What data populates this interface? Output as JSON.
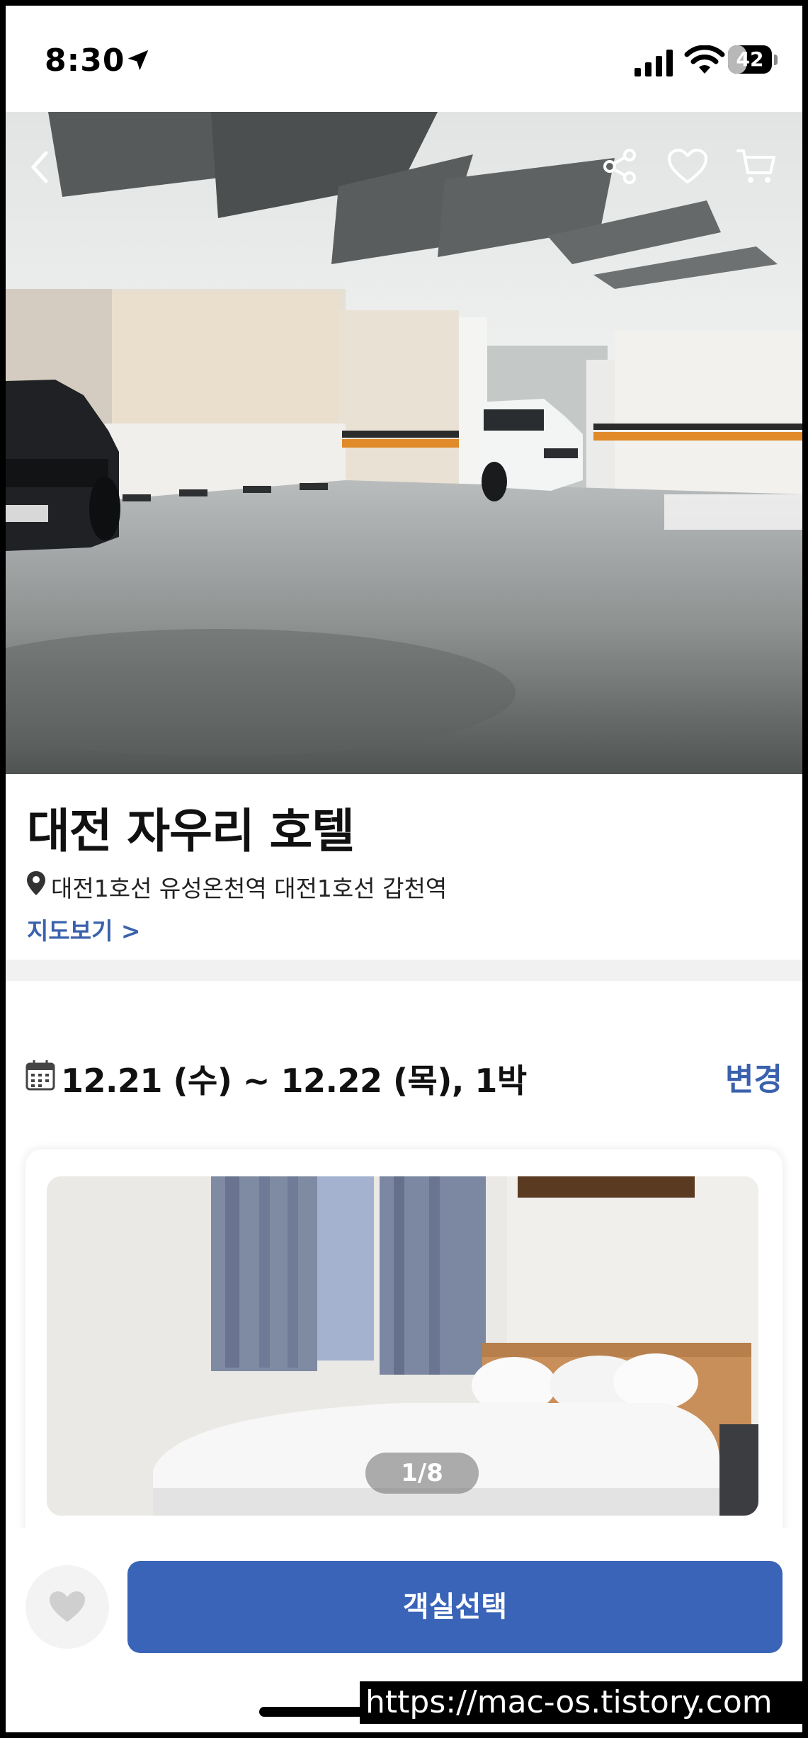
{
  "status_bar": {
    "time": "8:30",
    "battery_level": 42,
    "battery_text": "42",
    "icons": [
      "location-arrow-icon",
      "cellular-signal-icon",
      "wifi-icon",
      "battery-icon"
    ]
  },
  "hero": {
    "icons": [
      "back-chevron-icon",
      "share-icon",
      "heart-outline-icon",
      "cart-icon"
    ]
  },
  "hotel": {
    "name": "대전 자우리 호텔",
    "stations": "대전1호선 유성온천역 대전1호선 갑천역",
    "map_link": "지도보기 >"
  },
  "booking": {
    "date_range": "12.21 (수) ~ 12.22 (목), 1박",
    "change_label": "변경"
  },
  "room": {
    "photo_index": "1/8"
  },
  "bottom": {
    "select_label": "객실선택"
  },
  "watermark": "https://mac-os.tistory.com",
  "colors": {
    "accent": "#3a61ad",
    "button": "#3a64b8",
    "divider": "#f1f1f1"
  }
}
